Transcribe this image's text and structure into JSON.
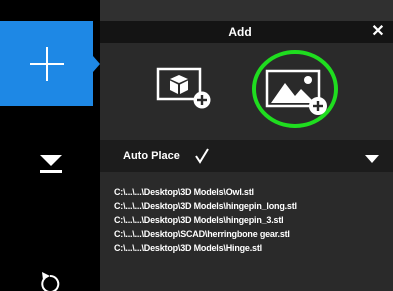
{
  "panel": {
    "title": "Add",
    "close_icon": "close-icon",
    "add_model_icon": "cube-add-icon",
    "add_image_icon": "image-add-icon",
    "highlight_color": "#1fdd1f",
    "accent_color": "#1e88e5"
  },
  "toolbar": {
    "items": [
      {
        "name": "add",
        "icon": "plus-icon",
        "active": true
      },
      {
        "name": "lay-flat",
        "icon": "lay-flat-icon",
        "active": false
      },
      {
        "name": "undo",
        "icon": "undo-icon",
        "active": false
      }
    ]
  },
  "auto_place": {
    "label": "Auto Place",
    "checked": true
  },
  "recent_files": [
    "C:\\...\\...\\Desktop\\3D Models\\Owl.stl",
    "C:\\...\\...\\Desktop\\3D Models\\hingepin_long.stl",
    "C:\\...\\...\\Desktop\\3D Models\\hingepin_3.stl",
    "C:\\...\\...\\Desktop\\SCAD\\herringbone gear.stl",
    "C:\\...\\...\\Desktop\\3D Models\\Hinge.stl"
  ]
}
